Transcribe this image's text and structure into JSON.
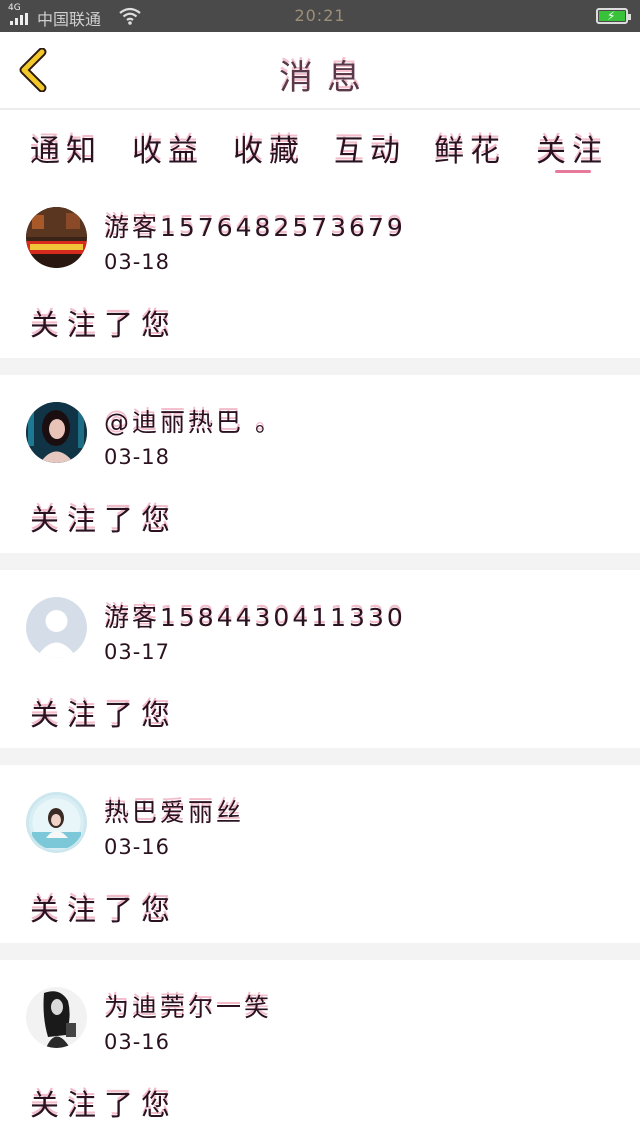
{
  "status_bar": {
    "network": "4G",
    "carrier": "中国联通",
    "time": "20:21"
  },
  "header": {
    "title": "消息",
    "back_icon": "chevron-left-icon",
    "back_color": "#f3c92a"
  },
  "tabs": [
    {
      "label": "通知"
    },
    {
      "label": "收益"
    },
    {
      "label": "收藏"
    },
    {
      "label": "互动"
    },
    {
      "label": "鲜花"
    },
    {
      "label": "关注",
      "active": true
    }
  ],
  "accent_color": "#e77a9b",
  "messages": [
    {
      "username": "游客1576482573679",
      "date": "03-18",
      "action": "关注了您",
      "avatar": "photo-avatar-storefront"
    },
    {
      "username": "@迪丽热巴 。",
      "date": "03-18",
      "action": "关注了您",
      "avatar": "photo-avatar-woman"
    },
    {
      "username": "游客1584430411330",
      "date": "03-17",
      "action": "关注了您",
      "avatar": "default-user-icon"
    },
    {
      "username": "热巴爱丽丝",
      "date": "03-16",
      "action": "关注了您",
      "avatar": "photo-avatar-beach"
    },
    {
      "username": "为迪莞尔一笑",
      "date": "03-16",
      "action": "关注了您",
      "avatar": "photo-avatar-bw"
    }
  ]
}
